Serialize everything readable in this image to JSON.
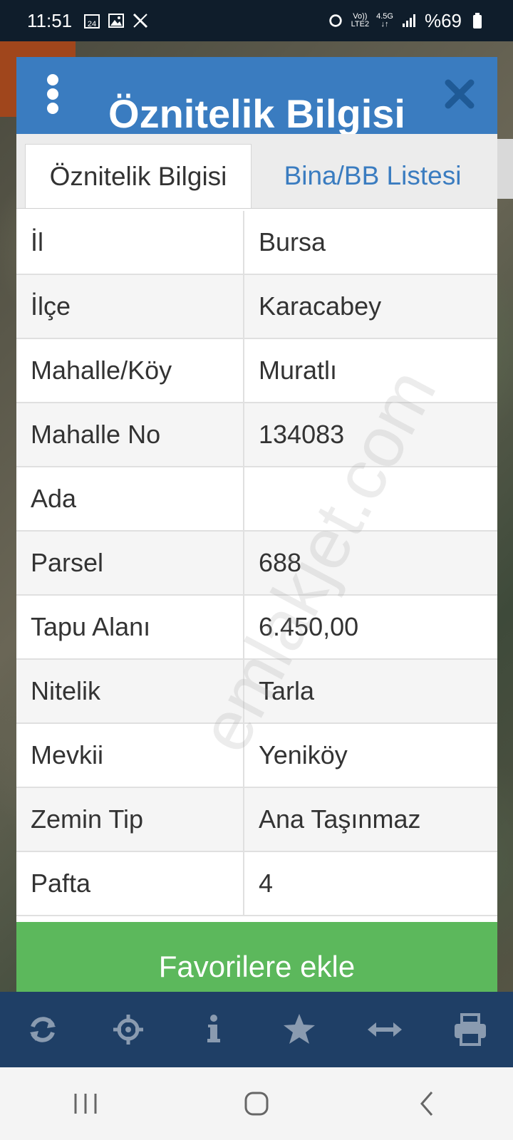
{
  "status_bar": {
    "time": "11:51",
    "calendar_day": "24",
    "network_top": "Vo))",
    "network_bottom": "LTE2",
    "network_gen": "4.5G",
    "battery_text": "%69"
  },
  "dialog": {
    "title": "Öznitelik Bilgisi",
    "tabs": [
      {
        "label": "Öznitelik Bilgisi",
        "active": true
      },
      {
        "label": "Bina/BB Listesi",
        "active": false
      }
    ],
    "rows": [
      {
        "key": "İl",
        "value": "Bursa"
      },
      {
        "key": "İlçe",
        "value": "Karacabey"
      },
      {
        "key": "Mahalle/Köy",
        "value": "Muratlı"
      },
      {
        "key": "Mahalle No",
        "value": "134083"
      },
      {
        "key": "Ada",
        "value": ""
      },
      {
        "key": "Parsel",
        "value": "688"
      },
      {
        "key": "Tapu Alanı",
        "value": "6.450,00"
      },
      {
        "key": "Nitelik",
        "value": "Tarla"
      },
      {
        "key": "Mevkii",
        "value": "Yeniköy"
      },
      {
        "key": "Zemin Tip",
        "value": "Ana Taşınmaz"
      },
      {
        "key": "Pafta",
        "value": "4"
      }
    ],
    "favorite_button": "Favorilere ekle"
  },
  "watermark": "emlakjet.com",
  "toolbar": {
    "icons": [
      "refresh-icon",
      "crosshair-icon",
      "info-icon",
      "star-icon",
      "measure-icon",
      "print-icon"
    ]
  },
  "navbar": {
    "icons": [
      "recent-apps-icon",
      "home-icon",
      "back-icon"
    ]
  },
  "colors": {
    "header_blue": "#3a7cc0",
    "button_green": "#5cb85c",
    "toolbar_navy": "#1f3f66",
    "tab_link_blue": "#3a7cc0"
  }
}
